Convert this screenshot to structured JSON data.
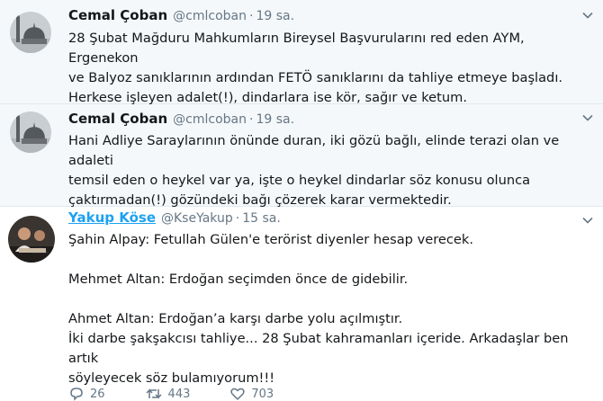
{
  "tweets": [
    {
      "name": "Cemal Çoban",
      "handle": "@cmlcoban",
      "dot": "·",
      "time": "19 sa.",
      "lines": [
        "28 Şubat Mağduru Mahkumların Bireysel Başvurularını red eden AYM, Ergenekon",
        "ve Balyoz sanıklarının ardından FETÖ sanıklarını da tahliye etmeye başladı.",
        "Herkese işleyen adalet(!), dindarlara ise kör, sağır ve ketum."
      ]
    },
    {
      "name": "Cemal Çoban",
      "handle": "@cmlcoban",
      "dot": "·",
      "time": "19 sa.",
      "lines": [
        "Hani Adliye Saraylarının önünde duran, iki gözü bağlı, elinde terazi olan ve adaleti",
        "temsil eden o heykel var ya, işte o heykel dindarlar söz konusu olunca",
        "çaktırmadan(!) gözündeki bağı çözerek karar vermektedir."
      ]
    },
    {
      "name": "Yakup Köse",
      "handle": "@KseYakup",
      "dot": "·",
      "time": "15 sa.",
      "lines": [
        "Şahin Alpay: Fetullah Gülen'e terörist diyenler hesap verecek.",
        "",
        "Mehmet Altan: Erdoğan seçimden önce de gidebilir.",
        "",
        "Ahmet Altan: Erdoğan’a karşı darbe yolu açılmıştır.",
        "İki darbe şakşakcısı tahliye... 28 Şubat kahramanları içeride. Arkadaşlar ben artık",
        "söyleyecek söz bulamıyorum!!!"
      ],
      "actions": {
        "replies": "26",
        "retweets": "443",
        "likes": "703"
      }
    }
  ],
  "icons": {
    "chevron": "chevron-down-icon",
    "reply": "reply-icon",
    "retweet": "retweet-icon",
    "like": "heart-icon"
  },
  "colors": {
    "link": "#1da1f2",
    "muted": "#657786",
    "highlight_bg": "#f5f8fa"
  }
}
